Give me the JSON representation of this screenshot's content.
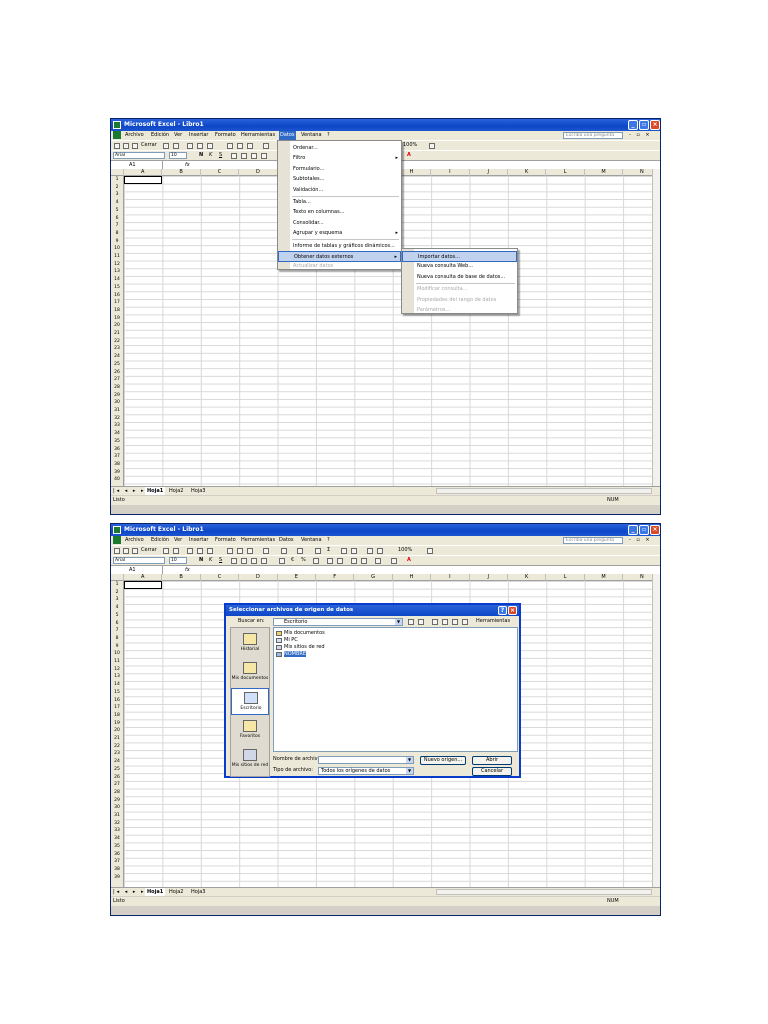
{
  "app": {
    "title": "Microsoft Excel - Libro1",
    "menu": [
      "Archivo",
      "Edición",
      "Ver",
      "Insertar",
      "Formato",
      "Herramientas",
      "Datos",
      "Ventana",
      "?"
    ],
    "help_placeholder": "Escriba una pregunta",
    "window_controls": "- ▫ ×",
    "font_name": "Arial",
    "font_size": "10",
    "cerrar_label": "Cerrar",
    "zoom": "100%",
    "name_box": "A1",
    "fx": "fx",
    "columns": [
      "A",
      "B",
      "C",
      "D",
      "E",
      "F",
      "G",
      "H",
      "I",
      "J",
      "K",
      "L",
      "M",
      "N"
    ],
    "rows": [
      "1",
      "2",
      "3",
      "4",
      "5",
      "6",
      "7",
      "8",
      "9",
      "10",
      "11",
      "12",
      "13",
      "14",
      "15",
      "16",
      "17",
      "18",
      "19",
      "20",
      "21",
      "22",
      "23",
      "24",
      "25",
      "26",
      "27",
      "28",
      "29",
      "30",
      "31",
      "32",
      "33",
      "34",
      "35",
      "36",
      "37",
      "38",
      "39",
      "40",
      "41"
    ],
    "sheets": [
      "Hoja1",
      "Hoja2",
      "Hoja3"
    ],
    "status_left": "Listo",
    "status_right": "NUM"
  },
  "datos_menu": {
    "items": [
      {
        "label": "Ordenar...",
        "submenu": false,
        "disabled": false
      },
      {
        "label": "Filtro",
        "submenu": true,
        "disabled": false
      },
      {
        "label": "Formulario...",
        "submenu": false,
        "disabled": false
      },
      {
        "label": "Subtotales...",
        "submenu": false,
        "disabled": false
      },
      {
        "label": "Validación...",
        "submenu": false,
        "disabled": false
      },
      {
        "label": "Tabla...",
        "submenu": false,
        "disabled": false
      },
      {
        "label": "Texto en columnas...",
        "submenu": false,
        "disabled": false
      },
      {
        "label": "Consolidar...",
        "submenu": false,
        "disabled": false
      },
      {
        "label": "Agrupar y esquema",
        "submenu": true,
        "disabled": false
      },
      {
        "label": "Informe de tablas y gráficos dinámicos...",
        "submenu": false,
        "disabled": false
      },
      {
        "label": "Obtener datos externos",
        "submenu": true,
        "disabled": false,
        "highlighted": true
      },
      {
        "label": "Actualizar datos",
        "submenu": false,
        "disabled": true
      }
    ]
  },
  "external_submenu": {
    "items": [
      {
        "label": "Importar datos...",
        "disabled": false,
        "highlighted": true
      },
      {
        "label": "Nueva consulta Web...",
        "disabled": false
      },
      {
        "label": "Nueva consulta de base de datos...",
        "disabled": false
      },
      {
        "label": "Modificar consulta...",
        "disabled": true
      },
      {
        "label": "Propiedades del rango de datos",
        "disabled": true
      },
      {
        "label": "Parámetros...",
        "disabled": true
      }
    ]
  },
  "dialog": {
    "title": "Seleccionar archivos de origen de datos",
    "look_in_label": "Buscar en:",
    "look_in_value": "Escritorio",
    "tools_label": "Herramientas",
    "places": [
      "Historial",
      "Mis documentos",
      "Escritorio",
      "Favoritos",
      "Mis sitios de red"
    ],
    "files": [
      "Mis documentos",
      "Mi PC",
      "Mis sitios de red",
      "NOMBRE"
    ],
    "filename_label": "Nombre de archivo:",
    "filename_value": "",
    "filetype_label": "Tipo de archivo:",
    "filetype_value": "Todos los orígenes de datos",
    "new_source_button": "Nuevo origen...",
    "open_button": "Abrir",
    "cancel_button": "Cancelar"
  }
}
